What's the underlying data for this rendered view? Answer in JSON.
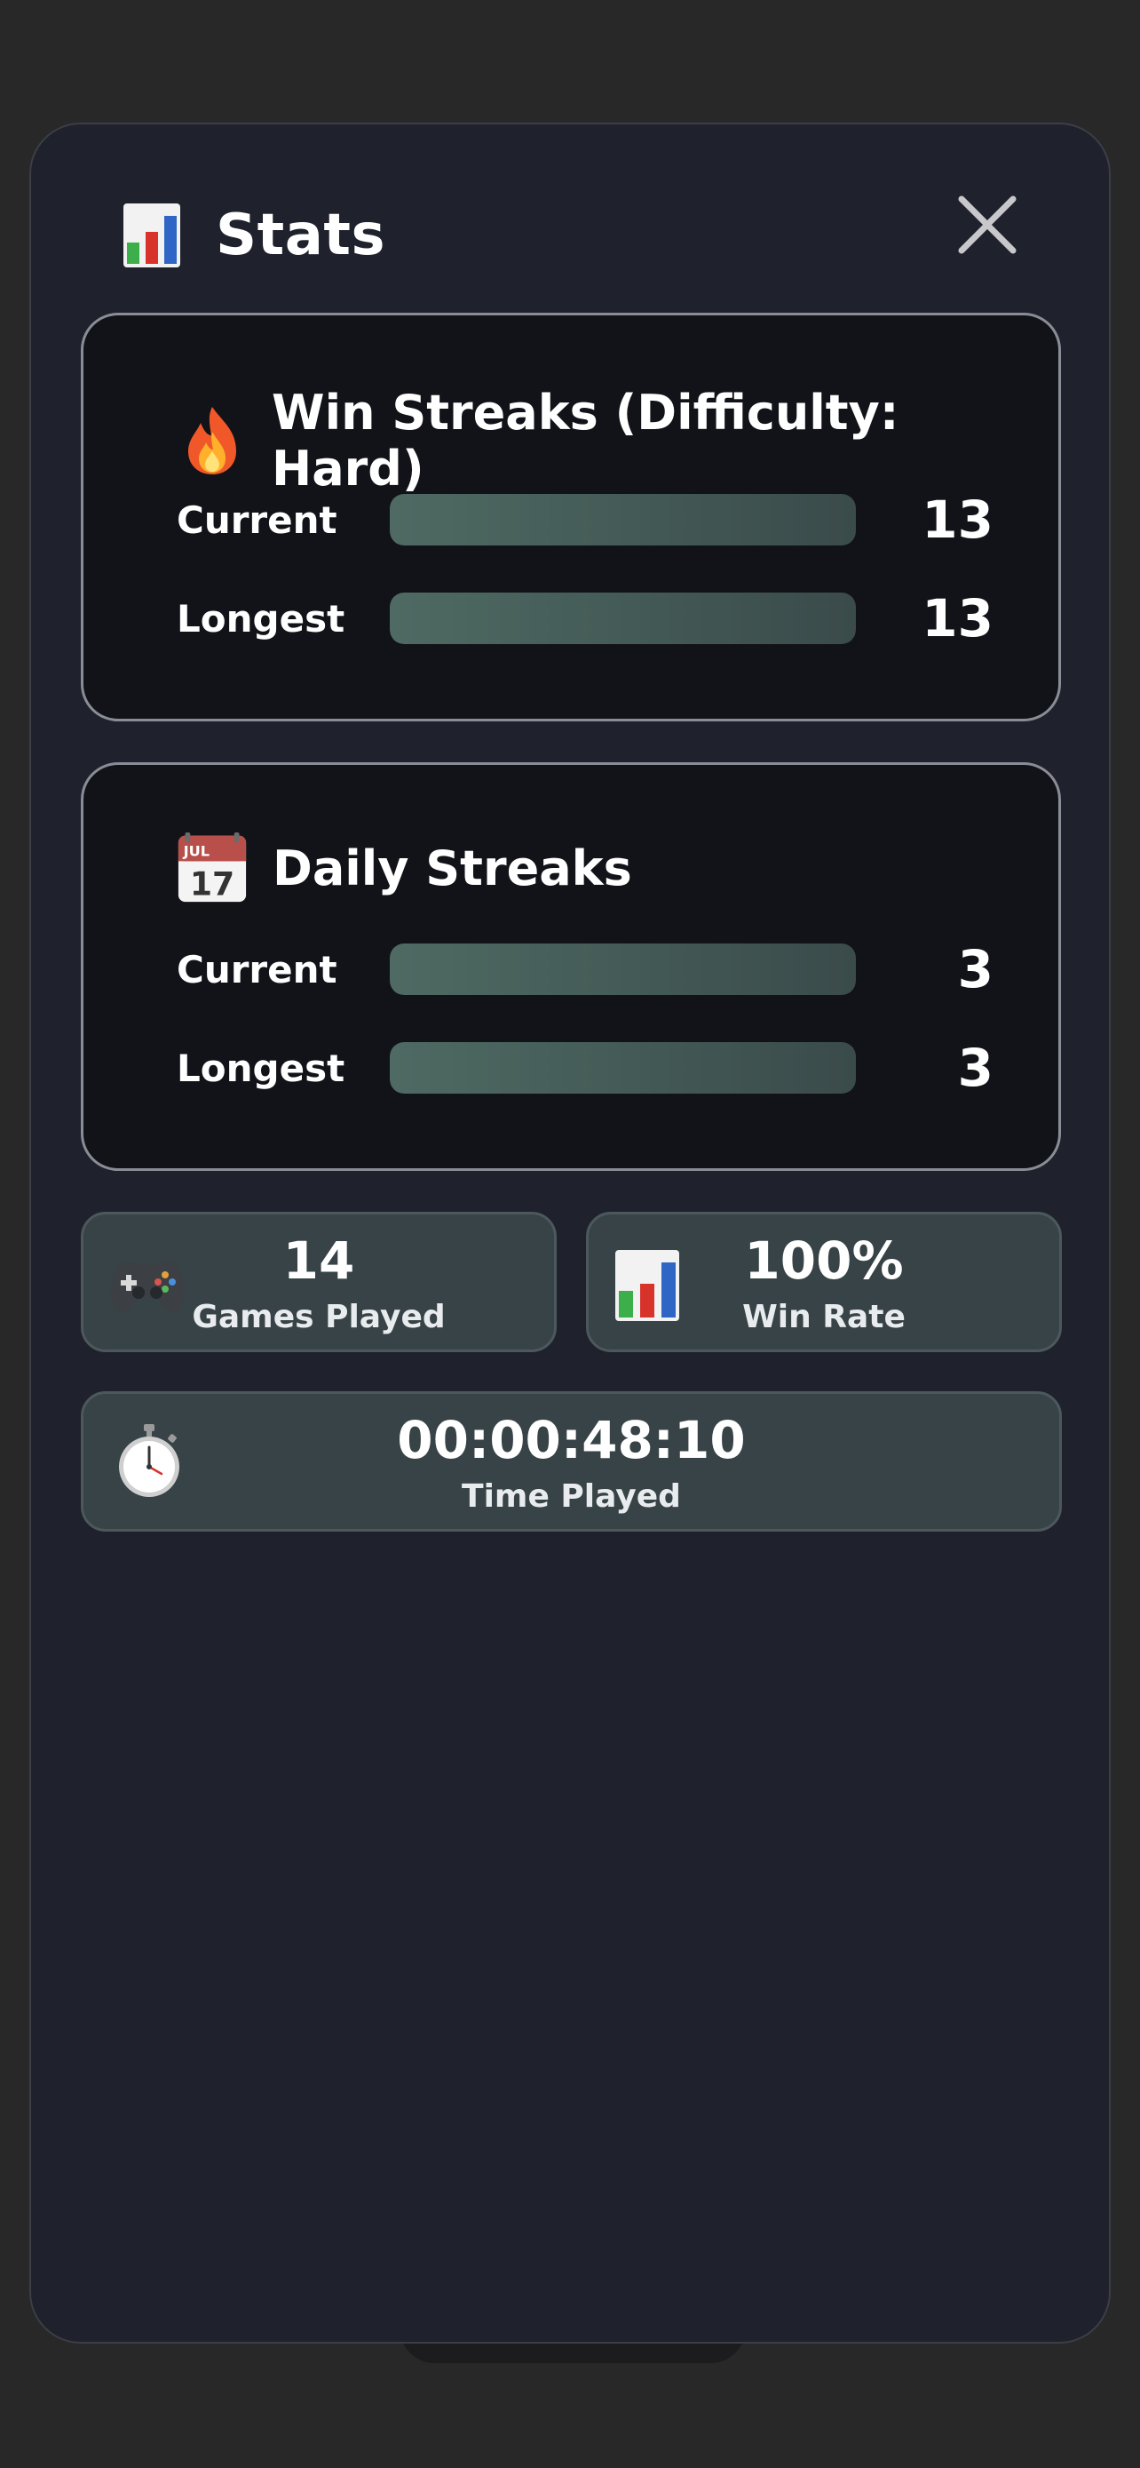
{
  "header": {
    "title": "Stats",
    "icon": "bar-chart-icon",
    "close_icon": "close-icon"
  },
  "win_streaks": {
    "title": "Win Streaks (Difficulty: Hard)",
    "icon": "fire-icon",
    "rows": [
      {
        "label": "Current",
        "value": "13",
        "fill_fraction": 1.0
      },
      {
        "label": "Longest",
        "value": "13",
        "fill_fraction": 1.0
      }
    ]
  },
  "daily_streaks": {
    "title": "Daily Streaks",
    "icon": "calendar-icon",
    "calendar_month": "JUL",
    "calendar_day": "17",
    "rows": [
      {
        "label": "Current",
        "value": "3",
        "fill_fraction": 1.0
      },
      {
        "label": "Longest",
        "value": "3",
        "fill_fraction": 1.0
      }
    ]
  },
  "tiles": {
    "games_played": {
      "value": "14",
      "label": "Games Played",
      "icon": "game-controller-icon"
    },
    "win_rate": {
      "value": "100%",
      "label": "Win Rate",
      "icon": "bar-chart-icon"
    },
    "time_played": {
      "value": "00:00:48:10",
      "label": "Time Played",
      "icon": "stopwatch-icon"
    }
  },
  "colors": {
    "modal_bg": "#1f222c",
    "card_bg": "#121319",
    "tile_bg": "#374346",
    "bar_fill": "#4e6a63"
  }
}
